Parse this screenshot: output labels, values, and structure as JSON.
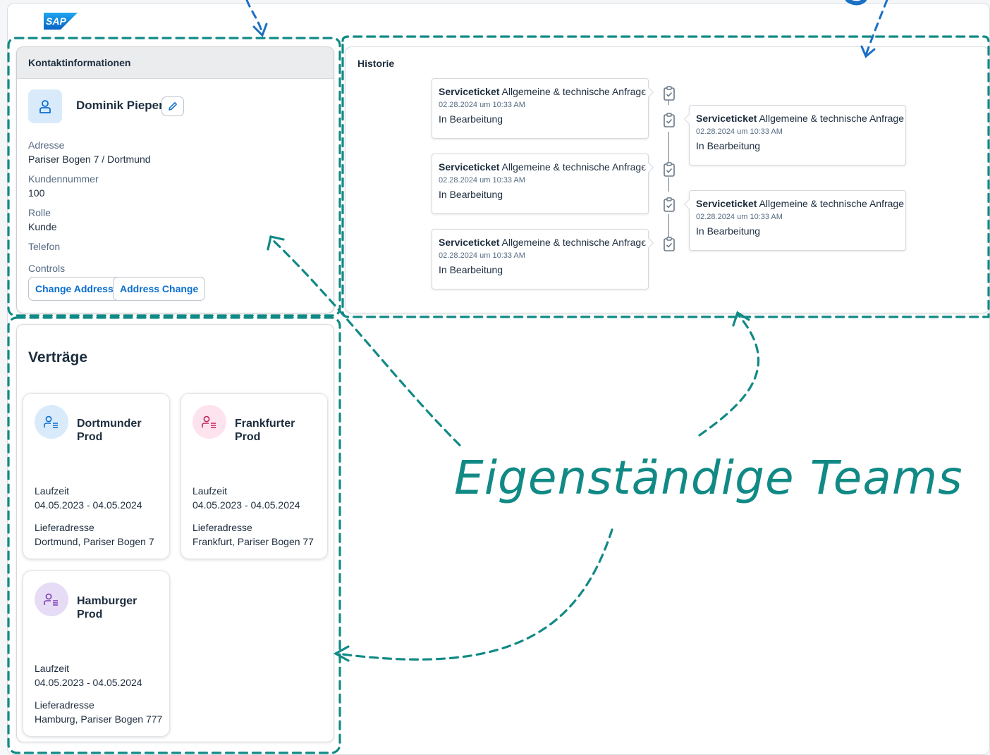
{
  "brand": {
    "logo_text": "SAP"
  },
  "contact": {
    "header": "Kontaktinformationen",
    "name": "Dominik Pieper",
    "fields": [
      {
        "label": "Adresse",
        "value": "Pariser Bogen 7 / Dortmund"
      },
      {
        "label": "Kundennummer",
        "value": "100"
      },
      {
        "label": "Rolle",
        "value": "Kunde"
      },
      {
        "label": "Telefon",
        "value": ""
      }
    ],
    "controls_label": "Controls",
    "buttons": [
      "Change Address",
      "Address Change"
    ]
  },
  "history": {
    "title": "Historie",
    "entries": [
      {
        "type": "Serviceticket",
        "subject": "Allgemeine & technische Anfrage",
        "date": "02.28.2024 um 10:33 AM",
        "status": "In Bearbeitung"
      },
      {
        "type": "Serviceticket",
        "subject": "Allgemeine & technische Anfrage",
        "date": "02.28.2024 um 10:33 AM",
        "status": "In Bearbeitung"
      },
      {
        "type": "Serviceticket",
        "subject": "Allgemeine & technische Anfrage",
        "date": "02.28.2024 um 10:33 AM",
        "status": "In Bearbeitung"
      },
      {
        "type": "Serviceticket",
        "subject": "Allgemeine & technische Anfrage",
        "date": "02.28.2024 um 10:33 AM",
        "status": "In Bearbeitung"
      },
      {
        "type": "Serviceticket",
        "subject": "Allgemeine & technische Anfrage",
        "date": "02.28.2024 um 10:33 AM",
        "status": "In Bearbeitung"
      }
    ]
  },
  "contracts": {
    "title": "Verträge",
    "items": [
      {
        "name": "Dortmunder Prod",
        "term_label": "Laufzeit",
        "term": "04.05.2023 - 04.05.2024",
        "address_label": "Lieferadresse",
        "address": "Dortmund, Pariser Bogen 7",
        "icon_bg": "#d9ebfb",
        "icon_color": "#0a6ed1"
      },
      {
        "name": "Frankfurter Prod",
        "term_label": "Laufzeit",
        "term": "04.05.2023 - 04.05.2024",
        "address_label": "Lieferadresse",
        "address": "Frankfurt, Pariser Bogen 77",
        "icon_bg": "#fde3ee",
        "icon_color": "#c0275e"
      },
      {
        "name": "Hamburger Prod",
        "term_label": "Laufzeit",
        "term": "04.05.2023 - 04.05.2024",
        "address_label": "Lieferadresse",
        "address": "Hamburg, Pariser Bogen 777",
        "icon_bg": "#e6dcf5",
        "icon_color": "#7b3fb5"
      }
    ]
  },
  "annotation": {
    "text": "Eigenständige Teams",
    "color": "#118a86",
    "arrow_color": "#1b6fc4"
  }
}
